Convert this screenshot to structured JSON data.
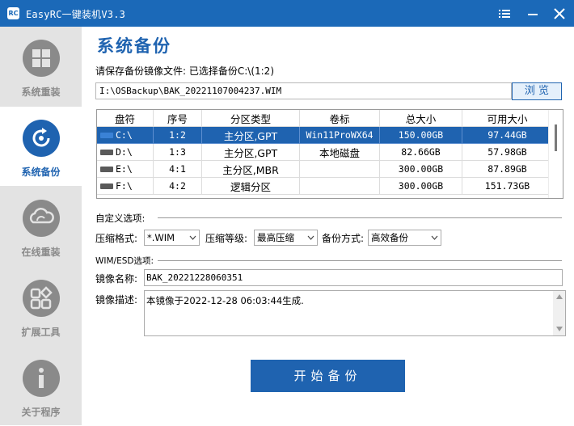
{
  "app": {
    "title": "EasyRC一键装机V3.3",
    "icon_text": "RC"
  },
  "window_controls": [
    "menu-icon",
    "minimize-icon",
    "close-icon"
  ],
  "sidebar": {
    "items": [
      {
        "label": "系统重装",
        "icon": "windows-icon",
        "active": false
      },
      {
        "label": "系统备份",
        "icon": "backup-icon",
        "active": true
      },
      {
        "label": "在线重装",
        "icon": "cloud-sync-icon",
        "active": false
      },
      {
        "label": "扩展工具",
        "icon": "tools-grid-icon",
        "active": false
      },
      {
        "label": "关于程序",
        "icon": "info-icon",
        "active": false
      }
    ]
  },
  "main": {
    "title": "系统备份",
    "save_prompt": "请保存备份镜像文件: 已选择备份C:\\(1:2)",
    "path_value": "I:\\OSBackup\\BAK_20221107004237.WIM",
    "browse_label": "浏 览"
  },
  "partitions": {
    "headers": [
      "盘符",
      "序号",
      "分区类型",
      "卷标",
      "总大小",
      "可用大小"
    ],
    "rows": [
      {
        "drive": "C:\\",
        "index": "1:2",
        "type": "主分区,GPT",
        "label": "Win11ProWX64",
        "total": "150.00GB",
        "free": "97.44GB",
        "selected": true
      },
      {
        "drive": "D:\\",
        "index": "1:3",
        "type": "主分区,GPT",
        "label": "本地磁盘",
        "total": "82.66GB",
        "free": "57.98GB",
        "selected": false
      },
      {
        "drive": "E:\\",
        "index": "4:1",
        "type": "主分区,MBR",
        "label": "",
        "total": "300.00GB",
        "free": "87.89GB",
        "selected": false
      },
      {
        "drive": "F:\\",
        "index": "4:2",
        "type": "逻辑分区",
        "label": "",
        "total": "300.00GB",
        "free": "151.73GB",
        "selected": false
      }
    ]
  },
  "options": {
    "section_label": "自定义选项:",
    "compress_format_label": "压缩格式:",
    "compress_format_value": "*.WIM",
    "compress_level_label": "压缩等级:",
    "compress_level_value": "最高压缩",
    "backup_mode_label": "备份方式:",
    "backup_mode_value": "高效备份"
  },
  "wim": {
    "section_label": "WIM/ESD选项:",
    "name_label": "镜像名称:",
    "name_value": "BAK_20221228060351",
    "desc_label": "镜像描述:",
    "desc_value": "本镜像于2022-12-28 06:03:44生成."
  },
  "start_button": "开始备份",
  "colors": {
    "accent": "#1f63b0",
    "titlebar": "#1b69b8",
    "sidebar_bg": "#e3e3e3"
  }
}
